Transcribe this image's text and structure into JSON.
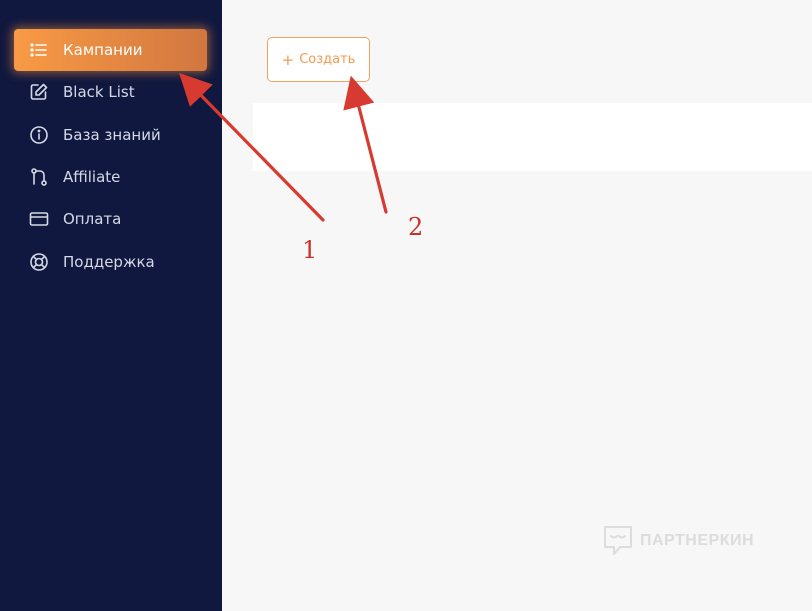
{
  "sidebar": {
    "items": [
      {
        "label": "Кампании",
        "icon": "list-icon",
        "active": true
      },
      {
        "label": "Black List",
        "icon": "edit-icon",
        "active": false
      },
      {
        "label": "База знаний",
        "icon": "info-icon",
        "active": false
      },
      {
        "label": "Affiliate",
        "icon": "git-branch-icon",
        "active": false
      },
      {
        "label": "Оплата",
        "icon": "credit-card-icon",
        "active": false
      },
      {
        "label": "Поддержка",
        "icon": "lifebuoy-icon",
        "active": false
      }
    ]
  },
  "main": {
    "create_button": {
      "icon": "plus-icon",
      "plus": "+",
      "label": "Создать"
    }
  },
  "watermark": {
    "text": "ПАРТНЕРКИН",
    "icon": "chat-bubble-icon"
  },
  "annotations": {
    "label_1": "1",
    "label_2": "2"
  },
  "colors": {
    "sidebar_bg": "#10183f",
    "accent": "#f39a4e",
    "arrow": "#d63a30",
    "main_bg": "#f7f7f7"
  }
}
